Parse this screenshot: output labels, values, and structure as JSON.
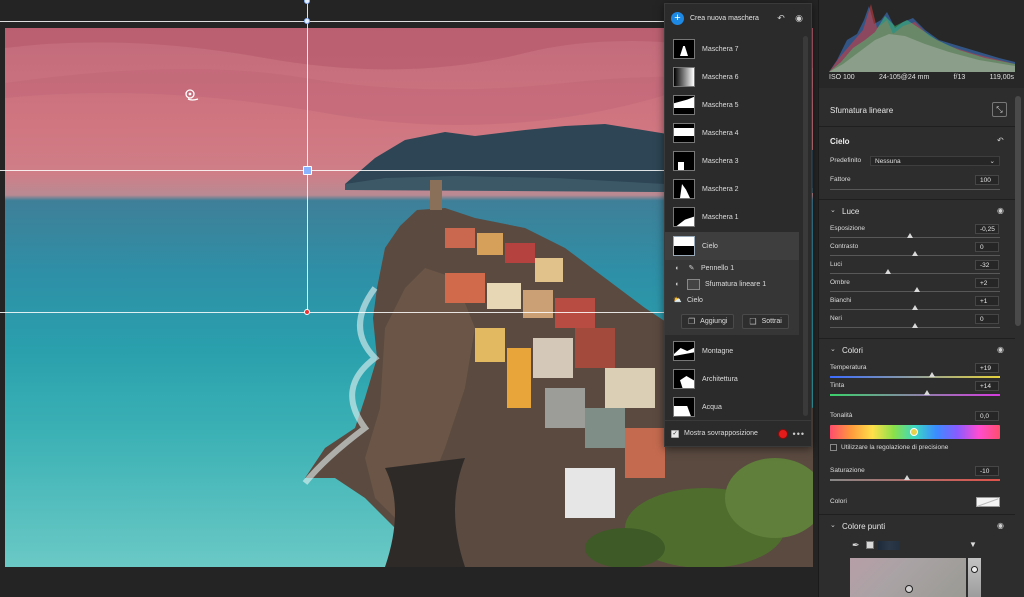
{
  "masks_panel": {
    "create_label": "Crea nuova maschera",
    "masks": [
      "Maschera 7",
      "Maschera 6",
      "Maschera 5",
      "Maschera 4",
      "Maschera 3",
      "Maschera 2",
      "Maschera 1"
    ],
    "active_mask": "Cielo",
    "components": [
      "Pennello 1",
      "Sfumatura lineare 1",
      "Cielo"
    ],
    "add_label": "Aggiungi",
    "subtract_label": "Sottrai",
    "masks_after": [
      "Montagne",
      "Architettura",
      "Acqua"
    ],
    "overlay_label": "Mostra sovrapposizione",
    "overlay_color": "#e31b1b"
  },
  "histogram": {
    "iso": "ISO 100",
    "lens": "24-105@24 mm",
    "aperture": "f/13",
    "shutter": "119,00s"
  },
  "tool": {
    "name": "Sfumatura lineare"
  },
  "section_cielo": {
    "title": "Cielo",
    "preset_label": "Predefinito",
    "preset_value": "Nessuna",
    "amount_label": "Fattore",
    "amount_value": "100"
  },
  "section_luce": {
    "title": "Luce",
    "sliders": [
      {
        "label": "Esposizione",
        "value": "-0,25",
        "pos": 0.47
      },
      {
        "label": "Contrasto",
        "value": "0",
        "pos": 0.5
      },
      {
        "label": "Luci",
        "value": "-32",
        "pos": 0.34
      },
      {
        "label": "Ombre",
        "value": "+2",
        "pos": 0.51
      },
      {
        "label": "Bianchi",
        "value": "+1",
        "pos": 0.5
      },
      {
        "label": "Neri",
        "value": "0",
        "pos": 0.5
      }
    ]
  },
  "section_colori": {
    "title": "Colori",
    "temperature_label": "Temperatura",
    "temperature_value": "+19",
    "temperature_pos": 0.6,
    "tint_label": "Tinta",
    "tint_value": "+14",
    "tint_pos": 0.57,
    "hue_label": "Tonalità",
    "hue_value": "0,0",
    "hue_pos": 0.5,
    "precision_label": "Utilizzare la regolazione di precisione",
    "saturation_label": "Saturazione",
    "saturation_value": "-10",
    "saturation_pos": 0.45,
    "colors_label": "Colori"
  },
  "section_points": {
    "title": "Colore punti"
  }
}
